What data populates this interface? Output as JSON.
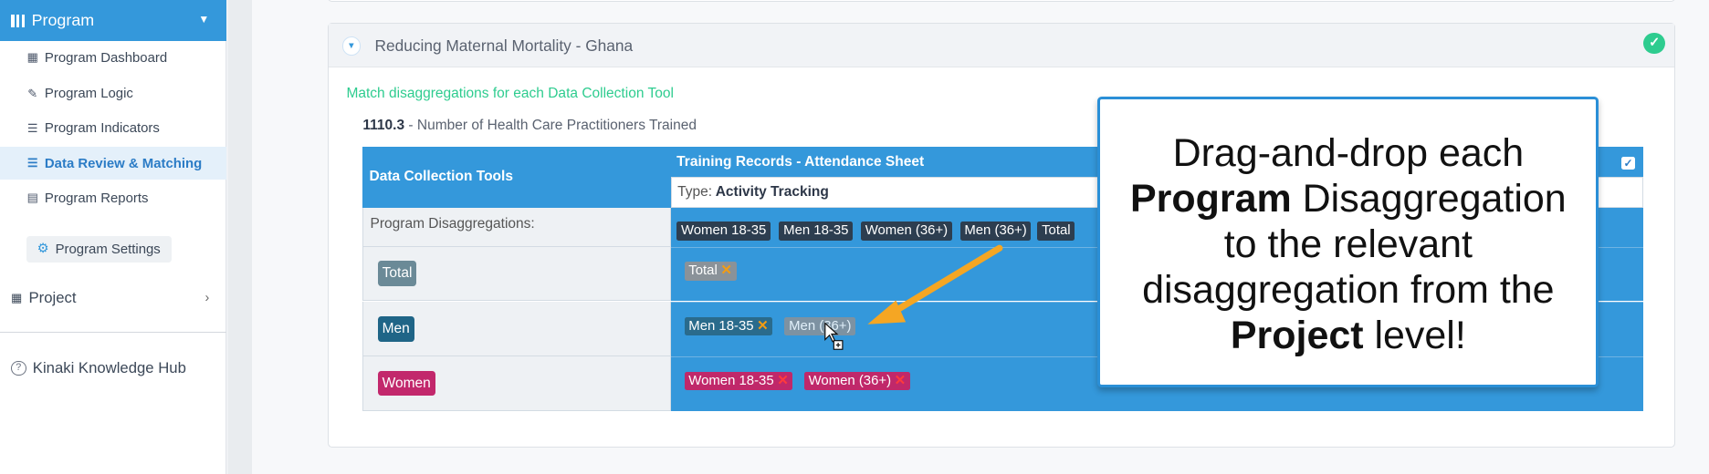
{
  "sidebar": {
    "program_label": "Program",
    "items": [
      {
        "label": "Program Dashboard",
        "icon": "dashboard-icon"
      },
      {
        "label": "Program Logic",
        "icon": "pencil-icon"
      },
      {
        "label": "Program Indicators",
        "icon": "list-icon"
      },
      {
        "label": "Data Review & Matching",
        "icon": "list-icon",
        "active": true
      },
      {
        "label": "Program Reports",
        "icon": "document-icon"
      }
    ],
    "settings_label": "Program Settings",
    "project_label": "Project",
    "hub_label": "Kinaki Knowledge Hub"
  },
  "card": {
    "title": "Reducing Maternal Mortality - Ghana",
    "match_title": "Match disaggregations for each Data Collection Tool",
    "indicator_code": "1110.3",
    "indicator_text": " - Number of Health Care Practitioners Trained"
  },
  "table": {
    "dct_header": "Data Collection Tools",
    "tool_name": "Training Records - Attendance Sheet",
    "type_label": "Type:",
    "type_value": "Activity Tracking",
    "program_disagg_label": "Program Disaggregations:",
    "program_disaggs": [
      "Women 18-35",
      "Men 18-35",
      "Women (36+)",
      "Men (36+)",
      "Total"
    ],
    "rows": [
      {
        "label": "Total",
        "chips": [
          "Total"
        ]
      },
      {
        "label": "Men",
        "chips": [
          "Men 18-35",
          "Men (36+)"
        ]
      },
      {
        "label": "Women",
        "chips": [
          "Women 18-35",
          "Women (36+)"
        ]
      }
    ]
  },
  "callout": {
    "line1": "Drag-and-drop each",
    "bold1": "Program",
    "line2": " Disaggregation",
    "line3": "to the relevant",
    "line4": "disaggregation from the",
    "bold2": "Project",
    "line5": " level!"
  },
  "colors": {
    "primary": "#3498db",
    "success": "#2ecc8f",
    "arrow": "#f5a623",
    "women": "#c2286c",
    "men": "#1f6587"
  }
}
